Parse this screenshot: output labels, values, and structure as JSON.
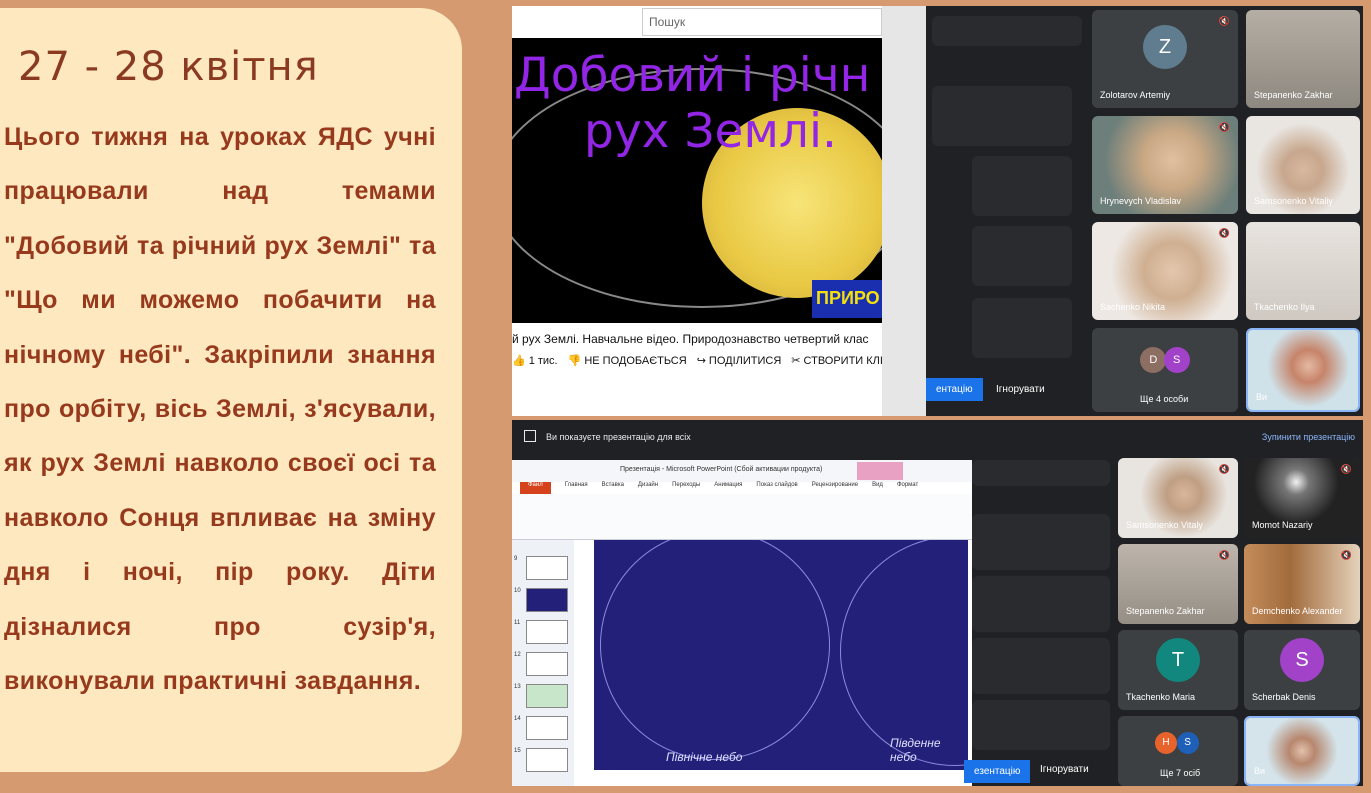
{
  "card": {
    "title": "27 - 28 квітня",
    "body": "Цього тижня на уроках ЯДС учні працювали над темами \"Добовий та річний рух Землі\" та  \"Що ми можемо побачити на нічному небі\". Закріпили знання про орбіту, вісь Землі, з'ясували, як рух Землі навколо своєї осі та навколо Сонця  впливає на зміну дня і ночі, пір року. Діти дізналися про сузір'я, виконували практичні завдання."
  },
  "top_screen": {
    "youtube": {
      "search_placeholder": "Пошук",
      "video_title_line1": "Добовий і річн",
      "video_title_line2": "рух Землі.",
      "video_badge": "ПРИРО",
      "caption": "й рух Землі. Навчальне відео. Природознавство четвертий клас",
      "likes": "1 тис.",
      "dislike": "НЕ ПОДОБАЄТЬСЯ",
      "share": "ПОДІЛИТИСЯ",
      "clip": "СТВОРИТИ КЛІ"
    },
    "present_button": "ентацію",
    "ignore_button": "Ігнорувати",
    "participants": [
      {
        "name": "Zolotarov Artemiy",
        "initial": "Z",
        "color": "#5f7d8e"
      },
      {
        "name": "Stepanenko Zakhar"
      },
      {
        "name": "Hrynevych Vladislav"
      },
      {
        "name": "Samsonenko Vitaliy"
      },
      {
        "name": "Sachenko Nikita"
      },
      {
        "name": "Tkachenko Ilya"
      },
      {
        "name": "Ще 4 особи",
        "initials": [
          "D",
          "S"
        ]
      },
      {
        "name": "Ви"
      }
    ]
  },
  "bottom_screen": {
    "presenting_text": "Ви показуєте презентацію для всіх",
    "stop_presenting": "Зупинити презентацію",
    "ppt": {
      "title": "Презентація - Microsoft PowerPoint (Сбой активации продукта)",
      "tabs": [
        "Файл",
        "Главная",
        "Вставка",
        "Дизайн",
        "Переходы",
        "Анимация",
        "Показ слайдов",
        "Рецензирование",
        "Вид",
        "Формат"
      ],
      "thumb_numbers": [
        "9",
        "10",
        "11",
        "12",
        "13",
        "14",
        "15"
      ],
      "north_sky": "Північне небо",
      "south_sky": "Південне небо"
    },
    "present_button": "езентацію",
    "ignore_button": "Ігнорувати",
    "participants": [
      {
        "name": "Samsonenko Vitaly"
      },
      {
        "name": "Momot Nazariy"
      },
      {
        "name": "Stepanenko Zakhar"
      },
      {
        "name": "Demchenko Alexander"
      },
      {
        "name": "Tkachenko Maria",
        "initial": "T",
        "color": "#12877e"
      },
      {
        "name": "Scherbak Denis",
        "initial": "S",
        "color": "#a142c9"
      },
      {
        "name": "Ще 7 осіб",
        "initials": [
          "H",
          "S"
        ]
      },
      {
        "name": "Ви"
      }
    ]
  }
}
